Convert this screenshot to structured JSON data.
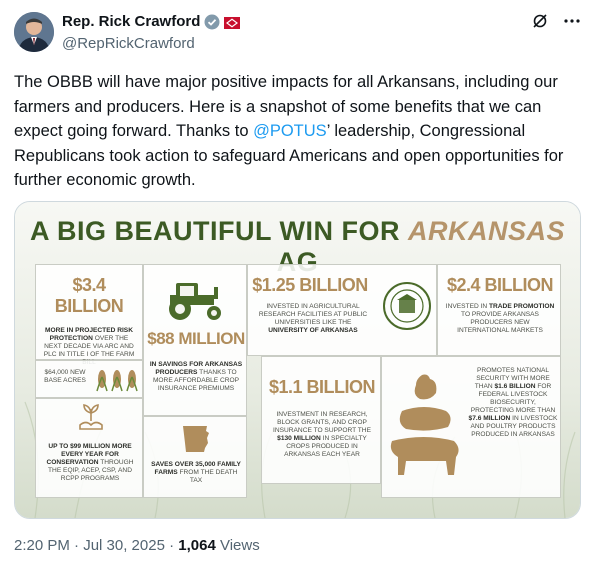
{
  "author": {
    "name": "Rep. Rick Crawford",
    "handle": "@RepRickCrawford"
  },
  "tweet": {
    "text_before": "The OBBB will have major positive impacts for all Arkansans, including our farmers and producers. Here is a snapshot of some benefits that we can expect going forward. Thanks to ",
    "mention": "@POTUS",
    "text_after": "’ leadership, Congressional Republicans took action to safeguard Americans and open opportunities for further economic growth."
  },
  "infographic": {
    "title_main": "A BIG BEAUTIFUL WIN FOR ",
    "title_accent": "ARKANSAS",
    "title_end": " AG",
    "cells": {
      "c1_amount": "$3.4 BILLION",
      "c1_text_bold": "MORE IN PROJECTED RISK PROTECTION",
      "c1_text": " OVER THE NEXT DECADE VIA ARC AND PLC IN TITLE I OF THE FARM BILL",
      "c1b_text": "$64,000 NEW BASE ACRES",
      "c2_amount": "$88 MILLION",
      "c2_text_bold": "IN SAVINGS FOR ARKANSAS PRODUCERS",
      "c2_text": " THANKS TO MORE AFFORDABLE CROP INSURANCE PREMIUMS",
      "c3_amount": "$1.25 BILLION",
      "c3_text": "INVESTED IN AGRICULTURAL RESEARCH FACILITIES AT PUBLIC UNIVERSITIES LIKE THE ",
      "c3_text_bold": "UNIVERSITY OF ARKANSAS",
      "c4_amount": "$2.4 BILLION",
      "c4_text": "INVESTED IN ",
      "c4_text_bold": "TRADE PROMOTION",
      "c4_text_end": " TO PROVIDE ARKANSAS PRODUCERS NEW INTERNATIONAL MARKETS",
      "c5_text_bold": "UP TO $99 MILLION MORE EVERY YEAR FOR CONSERVATION",
      "c5_text": " THROUGH THE EQIP, ACEP, CSP, AND RCPP PROGRAMS",
      "c6_text_bold": "SAVES OVER 35,000 FAMILY FARMS",
      "c6_text": " FROM THE DEATH TAX",
      "c7_amount": "$1.1 BILLION",
      "c7_text": "INVESTMENT IN RESEARCH, BLOCK GRANTS, AND CROP INSURANCE TO SUPPORT THE ",
      "c7_text_bold": "$130 MILLION",
      "c7_text_end": " IN SPECIALTY CROPS PRODUCED IN ARKANSAS EACH YEAR",
      "c8_text_a": "PROMOTES NATIONAL SECURITY WITH MORE THAN ",
      "c8_text_bold_a": "$1.6 BILLION",
      "c8_text_b": " FOR FEDERAL LIVESTOCK BIOSECURITY, PROTECTING MORE THAN ",
      "c8_text_bold_b": "$7.6 MILLION",
      "c8_text_c": " IN LIVESTOCK AND POULTRY PRODUCTS PRODUCED IN ARKANSAS",
      "seal_text": "UNIVERSITY OF ARKANSAS"
    }
  },
  "footer": {
    "time": "2:20 PM · Jul 30, 2025 · ",
    "views_count": "1,064",
    "views_label": " Views"
  },
  "icons": [
    "verified-badge-icon",
    "arkansas-flag-icon",
    "grok-icon",
    "more-icon"
  ]
}
